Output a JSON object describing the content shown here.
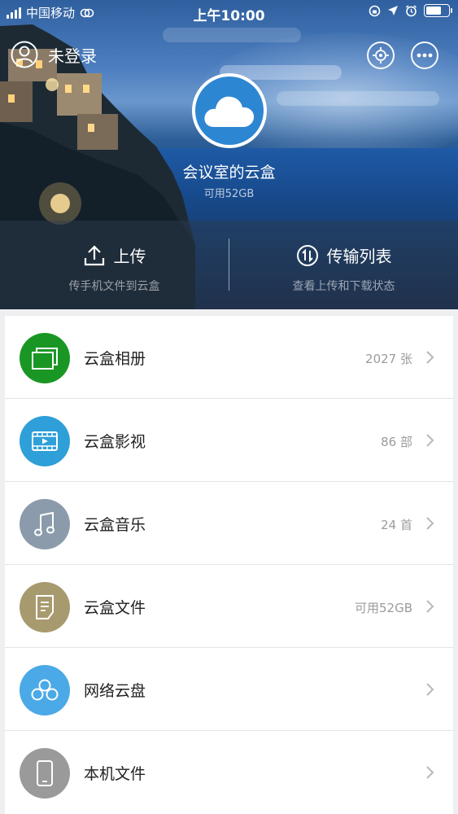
{
  "status_bar": {
    "carrier": "中国移动",
    "time": "上午10:00"
  },
  "header": {
    "login_label": "未登录",
    "box_name": "会议室的云盒",
    "box_capacity": "可用52GB"
  },
  "actions": [
    {
      "title": "上传",
      "subtitle": "传手机文件到云盒"
    },
    {
      "title": "传输列表",
      "subtitle": "查看上传和下载状态"
    }
  ],
  "menu": [
    {
      "label": "云盒相册",
      "meta": "2027 张",
      "icon": "photo-album-icon",
      "color": "#1a9624"
    },
    {
      "label": "云盒影视",
      "meta": "86 部",
      "icon": "film-icon",
      "color": "#2e9fd8"
    },
    {
      "label": "云盒音乐",
      "meta": "24 首",
      "icon": "music-note-icon",
      "color": "#8b9bab"
    },
    {
      "label": "云盒文件",
      "meta": "可用52GB",
      "icon": "document-icon",
      "color": "#a89a6f"
    },
    {
      "label": "网络云盘",
      "meta": "",
      "icon": "cloud-link-icon",
      "color": "#4aa9e6"
    },
    {
      "label": "本机文件",
      "meta": "",
      "icon": "phone-icon",
      "color": "#9a9a9a"
    }
  ],
  "colors": {
    "hero_top": "#2f5f9e",
    "brand_blue": "#2d86d2",
    "text_primary": "#222222",
    "text_secondary": "#9b9b9b"
  }
}
